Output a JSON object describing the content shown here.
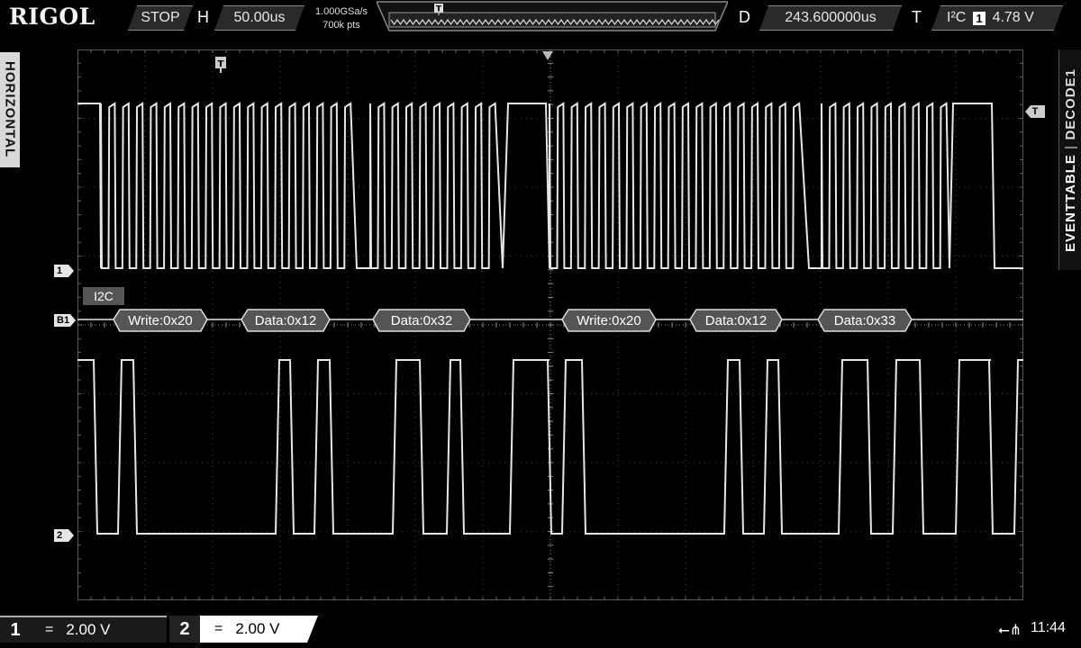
{
  "brand": "RIGOL",
  "run_state": "STOP",
  "horizontal": {
    "letter": "H",
    "timebase": "50.00us"
  },
  "sampling": {
    "rate": "1.000GSa/s",
    "points": "700k pts"
  },
  "delay": {
    "letter": "D",
    "value": "243.600000us"
  },
  "trigger": {
    "letter": "T",
    "type": "I²C",
    "source": "1",
    "level": "4.78 V",
    "marker": "T"
  },
  "side_tabs": {
    "left": "HORIZONTAL",
    "right_a": "EVENTTABLE",
    "right_b": "DECODE1"
  },
  "markers": {
    "ch1": "1",
    "bus": "B1",
    "ch2": "2",
    "trigger_right": "T"
  },
  "bus": {
    "label": "I2C",
    "frames": [
      {
        "text": "Write:0x20"
      },
      {
        "text": "Data:0x12"
      },
      {
        "text": "Data:0x32"
      },
      {
        "text": "Write:0x20"
      },
      {
        "text": "Data:0x12"
      },
      {
        "text": "Data:0x33"
      }
    ]
  },
  "channels": [
    {
      "num": "1",
      "coupling": "=",
      "scale": "2.00 V"
    },
    {
      "num": "2",
      "coupling": "=",
      "scale": "2.00 V"
    }
  ],
  "status": {
    "usb_icon": "usb-icon",
    "time": "11:44"
  },
  "colors": {
    "trace": "#e6e6e6",
    "grid": "#5a5a5a",
    "background": "#000000"
  }
}
